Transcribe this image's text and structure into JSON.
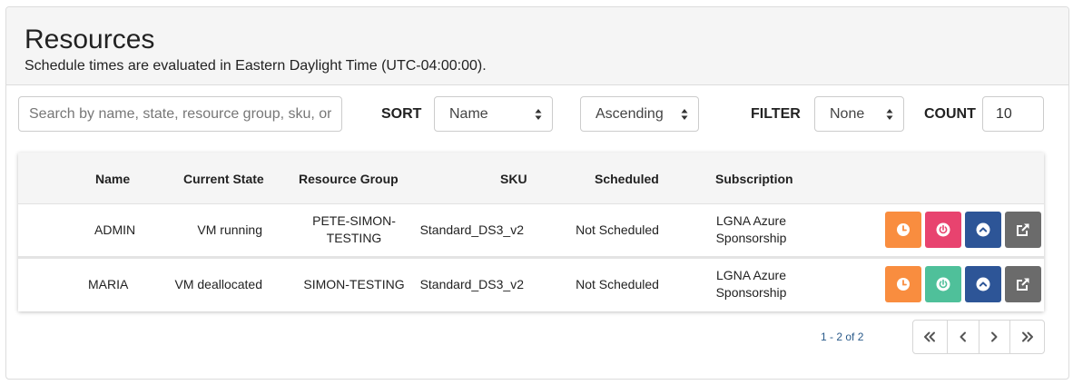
{
  "header": {
    "title": "Resources",
    "subtitle": "Schedule times are evaluated in Eastern Daylight Time (UTC-04:00:00)."
  },
  "toolbar": {
    "search_placeholder": "Search by name, state, resource group, sku, or subscription",
    "sort_label": "SORT",
    "sort_field": "Name",
    "sort_order": "Ascending",
    "filter_label": "FILTER",
    "filter_value": "None",
    "count_label": "COUNT",
    "count_value": "10"
  },
  "table": {
    "columns": [
      "Name",
      "Current State",
      "Resource Group",
      "SKU",
      "Scheduled",
      "Subscription"
    ],
    "rows": [
      {
        "name": "ADMIN",
        "state": "VM running",
        "resource_group": [
          "PETE-SIMON-",
          "TESTING"
        ],
        "sku": "Standard_DS3_v2",
        "scheduled": "Not Scheduled",
        "subscription": [
          "LGNA Azure",
          "Sponsorship"
        ],
        "power_color": "#e8436f"
      },
      {
        "name": "MARIA",
        "state": "VM deallocated",
        "resource_group": [
          "SIMON-TESTING"
        ],
        "sku": "Standard_DS3_v2",
        "scheduled": "Not Scheduled",
        "subscription": [
          "LGNA Azure",
          "Sponsorship"
        ],
        "power_color": "#4fc09a"
      }
    ],
    "action_icons": [
      "clock-icon",
      "power-icon",
      "chevron-up-icon",
      "external-link-icon"
    ]
  },
  "colors": {
    "schedule": "#f98d3f",
    "power_on": "#4fc09a",
    "power_off": "#e8436f",
    "details": "#2d5597",
    "open": "#6b6b6b"
  },
  "pagination": {
    "info": "1 - 2 of 2",
    "buttons": [
      "first-page-icon",
      "prev-page-icon",
      "next-page-icon",
      "last-page-icon"
    ]
  }
}
